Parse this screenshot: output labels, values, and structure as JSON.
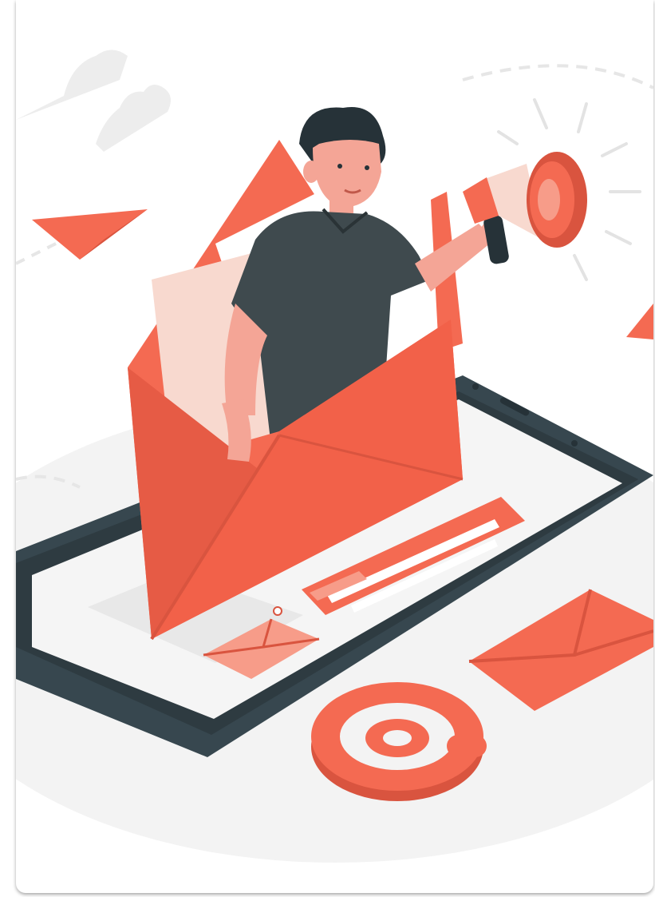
{
  "illustration": {
    "description_icon": "email-marketing-illustration",
    "colors": {
      "primary": "#F46A52",
      "primary_dark": "#D9543F",
      "primary_light": "#F79C89",
      "skin": "#F4A596",
      "paper": "#F8D9CF",
      "shirt": "#3F4A4E",
      "hair": "#263238",
      "device": "#37474F",
      "screen": "#F5F5F5",
      "ground": "#EFEFEF",
      "cloud": "#EBEBEB"
    },
    "icons": [
      "cloud-icon",
      "paper-plane-icon",
      "megaphone-icon",
      "envelope-icon",
      "at-sign-icon",
      "tablet-device"
    ]
  }
}
